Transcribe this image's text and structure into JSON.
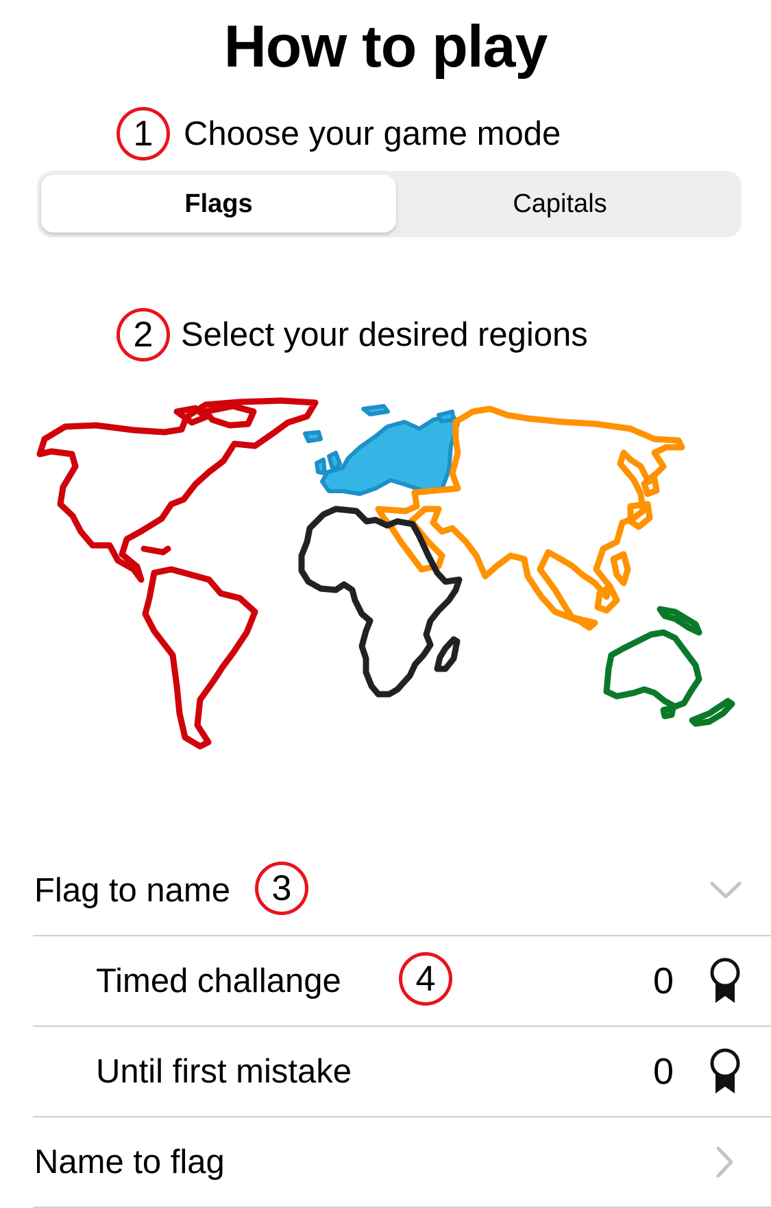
{
  "title": "How to play",
  "steps": {
    "one": {
      "number": "1",
      "text": "Choose your game mode"
    },
    "two": {
      "number": "2",
      "text": "Select your desired regions"
    },
    "three": {
      "number": "3"
    },
    "four": {
      "number": "4"
    }
  },
  "game_mode": {
    "options": [
      "Flags",
      "Capitals"
    ],
    "selected": "Flags"
  },
  "map": {
    "region_colors": {
      "americas": "#d0020a",
      "europe": "#2fb0e0",
      "africa": "#222222",
      "asia": "#ff9200",
      "oceania": "#0a7a2a"
    }
  },
  "list": {
    "flag_to_name": {
      "label": "Flag to name",
      "icon": "chevron-down-icon"
    },
    "timed_challenge": {
      "label": "Timed challange",
      "score": "0",
      "icon": "award-ribbon-icon"
    },
    "until_first_mistake": {
      "label": "Until first mistake",
      "score": "0",
      "icon": "award-ribbon-icon"
    },
    "name_to_flag": {
      "label": "Name to flag",
      "icon": "chevron-right-icon"
    }
  },
  "colors": {
    "badge_ring": "#e8141c",
    "separator": "#cfcfd2",
    "segment_bg": "#eeeeef"
  }
}
